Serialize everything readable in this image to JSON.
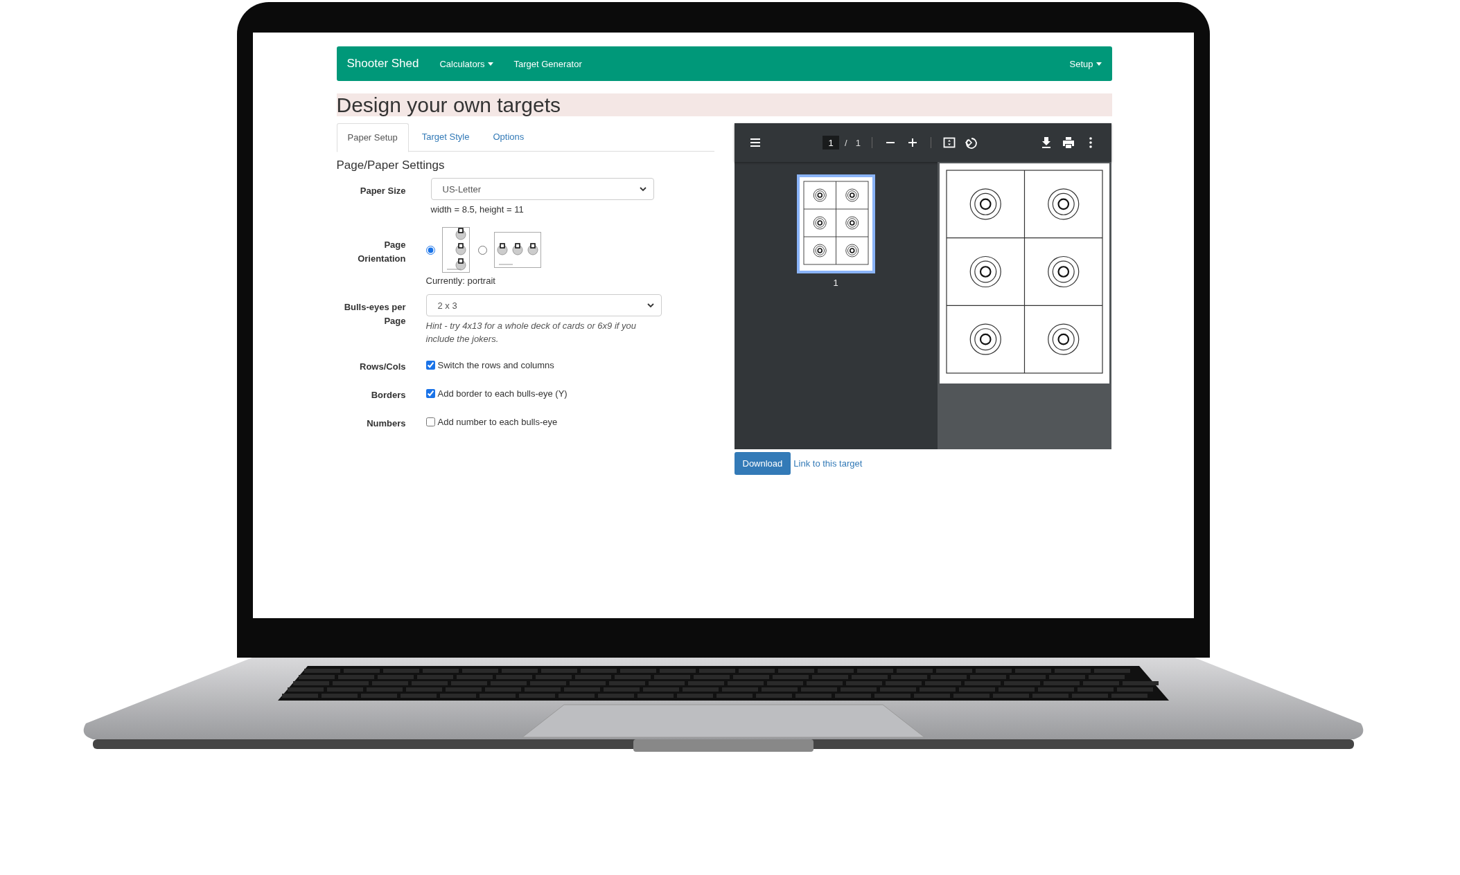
{
  "navbar": {
    "brand": "Shooter Shed",
    "items": [
      {
        "label": "Calculators",
        "dropdown": true
      },
      {
        "label": "Target Generator",
        "dropdown": false
      }
    ],
    "right_items": [
      {
        "label": "Setup",
        "dropdown": true
      }
    ]
  },
  "heading": "Design your own targets",
  "tabs": [
    {
      "label": "Paper Setup",
      "selected": true
    },
    {
      "label": "Target Style",
      "selected": false
    },
    {
      "label": "Options",
      "selected": false
    }
  ],
  "section_title": "Page/Paper Settings",
  "form": [
    {
      "kind": "select",
      "label": "Paper Size",
      "value": "US-Letter",
      "note": "width = 8.5, height = 11"
    },
    {
      "kind": "orientation",
      "label": "Page Orientation",
      "options": [
        {
          "kind": "portrait",
          "selected": true
        },
        {
          "kind": "landscape",
          "selected": false
        }
      ],
      "note": "Currently: portrait"
    },
    {
      "kind": "select",
      "label": "Bulls-eyes per Page",
      "value": "2 x 3",
      "hint": "Hint - try 4x13 for a whole deck of cards or 6x9 if you include the jokers."
    },
    {
      "kind": "checkbox",
      "label": "Rows/Cols",
      "text": "Switch the rows and columns",
      "checked": true
    },
    {
      "kind": "checkbox",
      "label": "Borders",
      "text": "Add border to each bulls-eye (Y)",
      "checked": true
    },
    {
      "kind": "checkbox",
      "label": "Numbers",
      "text": "Add number to each bulls-eye",
      "checked": false
    }
  ],
  "viewer": {
    "page_input": "1",
    "page_separator": "/",
    "page_total": "1",
    "thumbnails": [
      {
        "label": "1",
        "selected": true
      }
    ]
  },
  "actions": {
    "download_button": "Download",
    "link": "Link to this target"
  }
}
